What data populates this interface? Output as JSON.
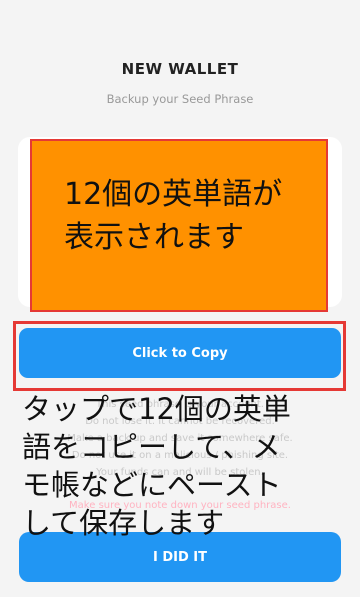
{
  "header": {
    "title": "NEW WALLET",
    "subtitle": "Backup your Seed Phrase"
  },
  "seed_overlay": {
    "text": "12個の英単語が\n表示されます"
  },
  "copy_button": {
    "label": "Click to Copy"
  },
  "warnings": [
    "This seed phrase is your account.",
    "Do not lose it. It cannot be recovered.",
    "Make a back up and save it somewhere safe.",
    "Do not use it on a malicious / phishing site.",
    "Your funds can and will be stolen."
  ],
  "agree_text": "Make sure you note down your seed phrase.",
  "done_button": {
    "label": "I DID IT"
  },
  "annotation": {
    "text": "タップで12個の英単\n語をコピーして、メ\nモ帳などにペースト\nして保存します"
  },
  "colors": {
    "accent": "#2196f3",
    "overlay": "#ff9100",
    "highlight_border": "#e53935"
  }
}
